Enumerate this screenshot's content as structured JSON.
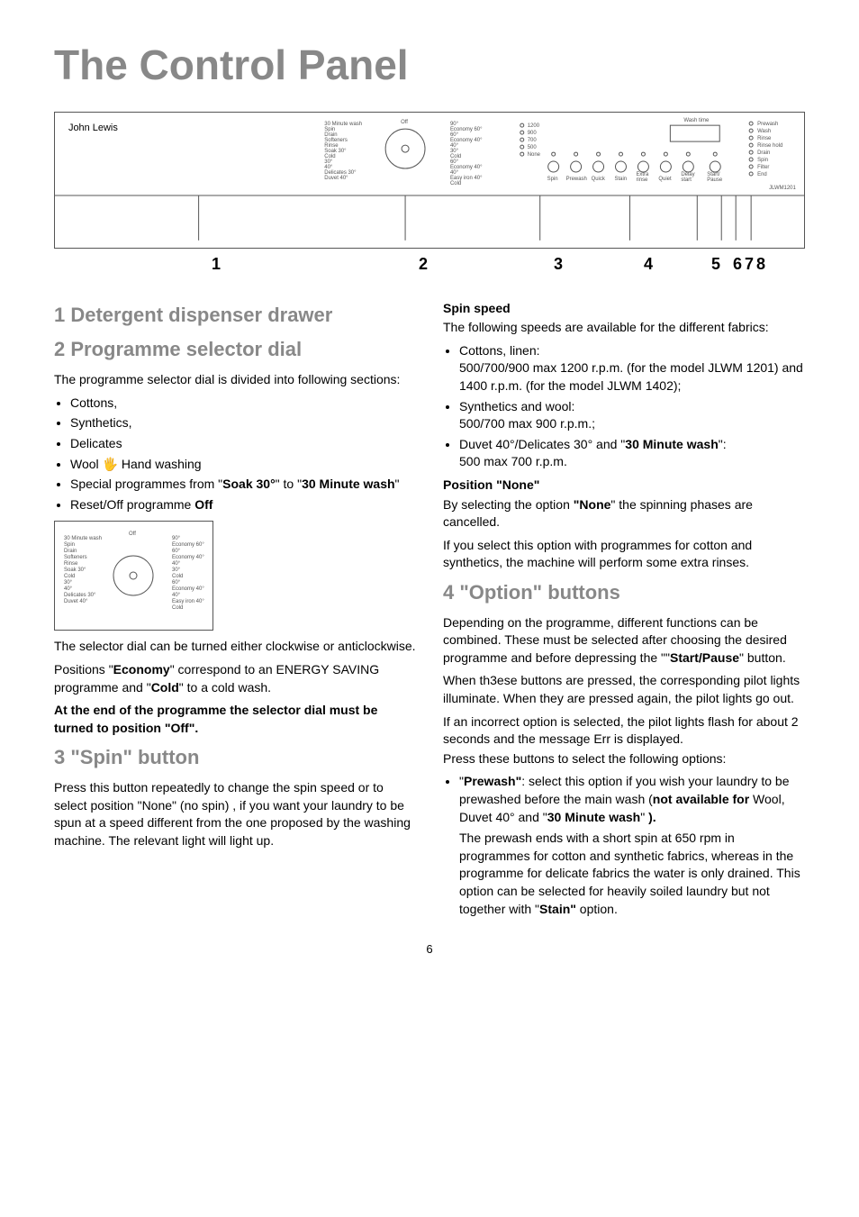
{
  "title": "The Control Panel",
  "brand": "John Lewis",
  "panel_model": "JLWM1201",
  "panel_dial_labels": [
    "30 Minute wash",
    "Spin",
    "Drain",
    "Softeners",
    "Rinse",
    "Soak 30°",
    "Cold",
    "30°",
    "40°",
    "Delicates 30°",
    "Duvet 40°",
    "Off",
    "90°",
    "Economy 60°",
    "60°",
    "Economy 40°",
    "40°",
    "30°",
    "Cold",
    "60°",
    "Economy 40°",
    "40°",
    "Easy iron 40°",
    "Cold"
  ],
  "panel_spin_speeds": [
    "1200",
    "900",
    "700",
    "500",
    "None"
  ],
  "panel_option_buttons": [
    "Spin",
    "Prewash",
    "Quick",
    "Stain",
    "Extra rinse",
    "Quiet",
    "Delay start",
    "Start/Pause"
  ],
  "panel_status_lights": [
    "Prewash",
    "Wash",
    "Rinse",
    "Rinse hold",
    "Drain",
    "Spin",
    "Filter",
    "End"
  ],
  "panel_wash_time_label": "Wash time",
  "diagram_numbers": {
    "n1": "1",
    "n2": "2",
    "n3": "3",
    "n4": "4",
    "n5": "5",
    "n678": "678"
  },
  "s1": {
    "heading": "1 Detergent dispenser drawer"
  },
  "s2": {
    "heading": "2 Programme selector dial",
    "intro": "The programme selector dial is divided into following sections:",
    "items": [
      "Cottons,",
      "Synthetics,",
      "Delicates"
    ],
    "wool_prefix": "Wool ",
    "wool_suffix": " Hand washing",
    "special_pre": "Special programmes from \"",
    "special_b1": "Soak 30°",
    "special_mid": "\" to \"",
    "special_b2": "30 Minute wash",
    "special_end": "\"",
    "reset_pre": "Reset/Off programme ",
    "reset_b": "Off",
    "below1": "The selector dial can be turned either clockwise or anticlockwise.",
    "pos_pre": "Positions \"",
    "pos_b1": "Economy",
    "pos_mid": "\" correspond to an ENERGY SAVING programme and \"",
    "pos_b2": "Cold",
    "pos_end": "\" to a cold wash.",
    "bold_note": "At the end of the programme the selector dial must be turned to position \"Off\"."
  },
  "s3": {
    "heading": "3 \"Spin\" button",
    "body": "Press this button repeatedly to change the spin speed or to select position \"None\" (no spin) , if you want your laundry to be spun at a speed different from the one proposed by the washing machine. The relevant light will light up."
  },
  "spin": {
    "h": "Spin speed",
    "intro": "The following speeds are available for the different fabrics:",
    "cotton_t": "Cottons, linen:",
    "cotton_b": "500/700/900 max 1200 r.p.m. (for the model JLWM 1201) and 1400 r.p.m. (for the model JLWM 1402);",
    "syn_t": "Synthetics and wool:",
    "syn_b": "500/700 max 900 r.p.m.;",
    "duvet_pre": "Duvet 40°/Delicates 30° and \"",
    "duvet_b": "30 Minute wash",
    "duvet_mid": "\":",
    "duvet_end": "500 max 700 r.p.m."
  },
  "none": {
    "h": "Position \"None\"",
    "l1_pre": "By selecting the option ",
    "l1_b": "\"None",
    "l1_end": "\" the spinning phases are cancelled.",
    "l2": "If you select this option with programmes for cotton and synthetics, the machine will perform some extra rinses."
  },
  "s4": {
    "heading": "4 \"Option\" buttons",
    "p1_pre": "Depending on the programme, different functions can be combined. These must be selected after choosing the desired programme and before depressing the \"\"",
    "p1_b": "Start/Pause",
    "p1_end": "\" button.",
    "p2": "When th3ese buttons are pressed, the corresponding pilot lights illuminate. When they are pressed again, the pilot lights go out.",
    "p3": "If an incorrect option is selected, the pilot lights flash for about 2 seconds and the message Err is displayed.",
    "p4": "Press these buttons to select the following options:",
    "pre_pre": "\"",
    "pre_b1": "Prewash\"",
    "pre_mid": ": select this option if you wish your laundry to be prewashed before the main wash (",
    "pre_b2": "not available for",
    "pre_mid2": " Wool, Duvet 40° and \"",
    "pre_b3": "30 Minute wash",
    "pre_end": "\" ",
    "pre_b4": ").",
    "pre_p2_pre": "The prewash ends with a short spin at 650 rpm in programmes for cotton and synthetic fabrics, whereas in the programme for delicate fabrics the water is only drained. This option can be selected for heavily soiled laundry but not together with \"",
    "pre_p2_b": "Stain\"",
    "pre_p2_end": " option."
  },
  "page_num": "6"
}
